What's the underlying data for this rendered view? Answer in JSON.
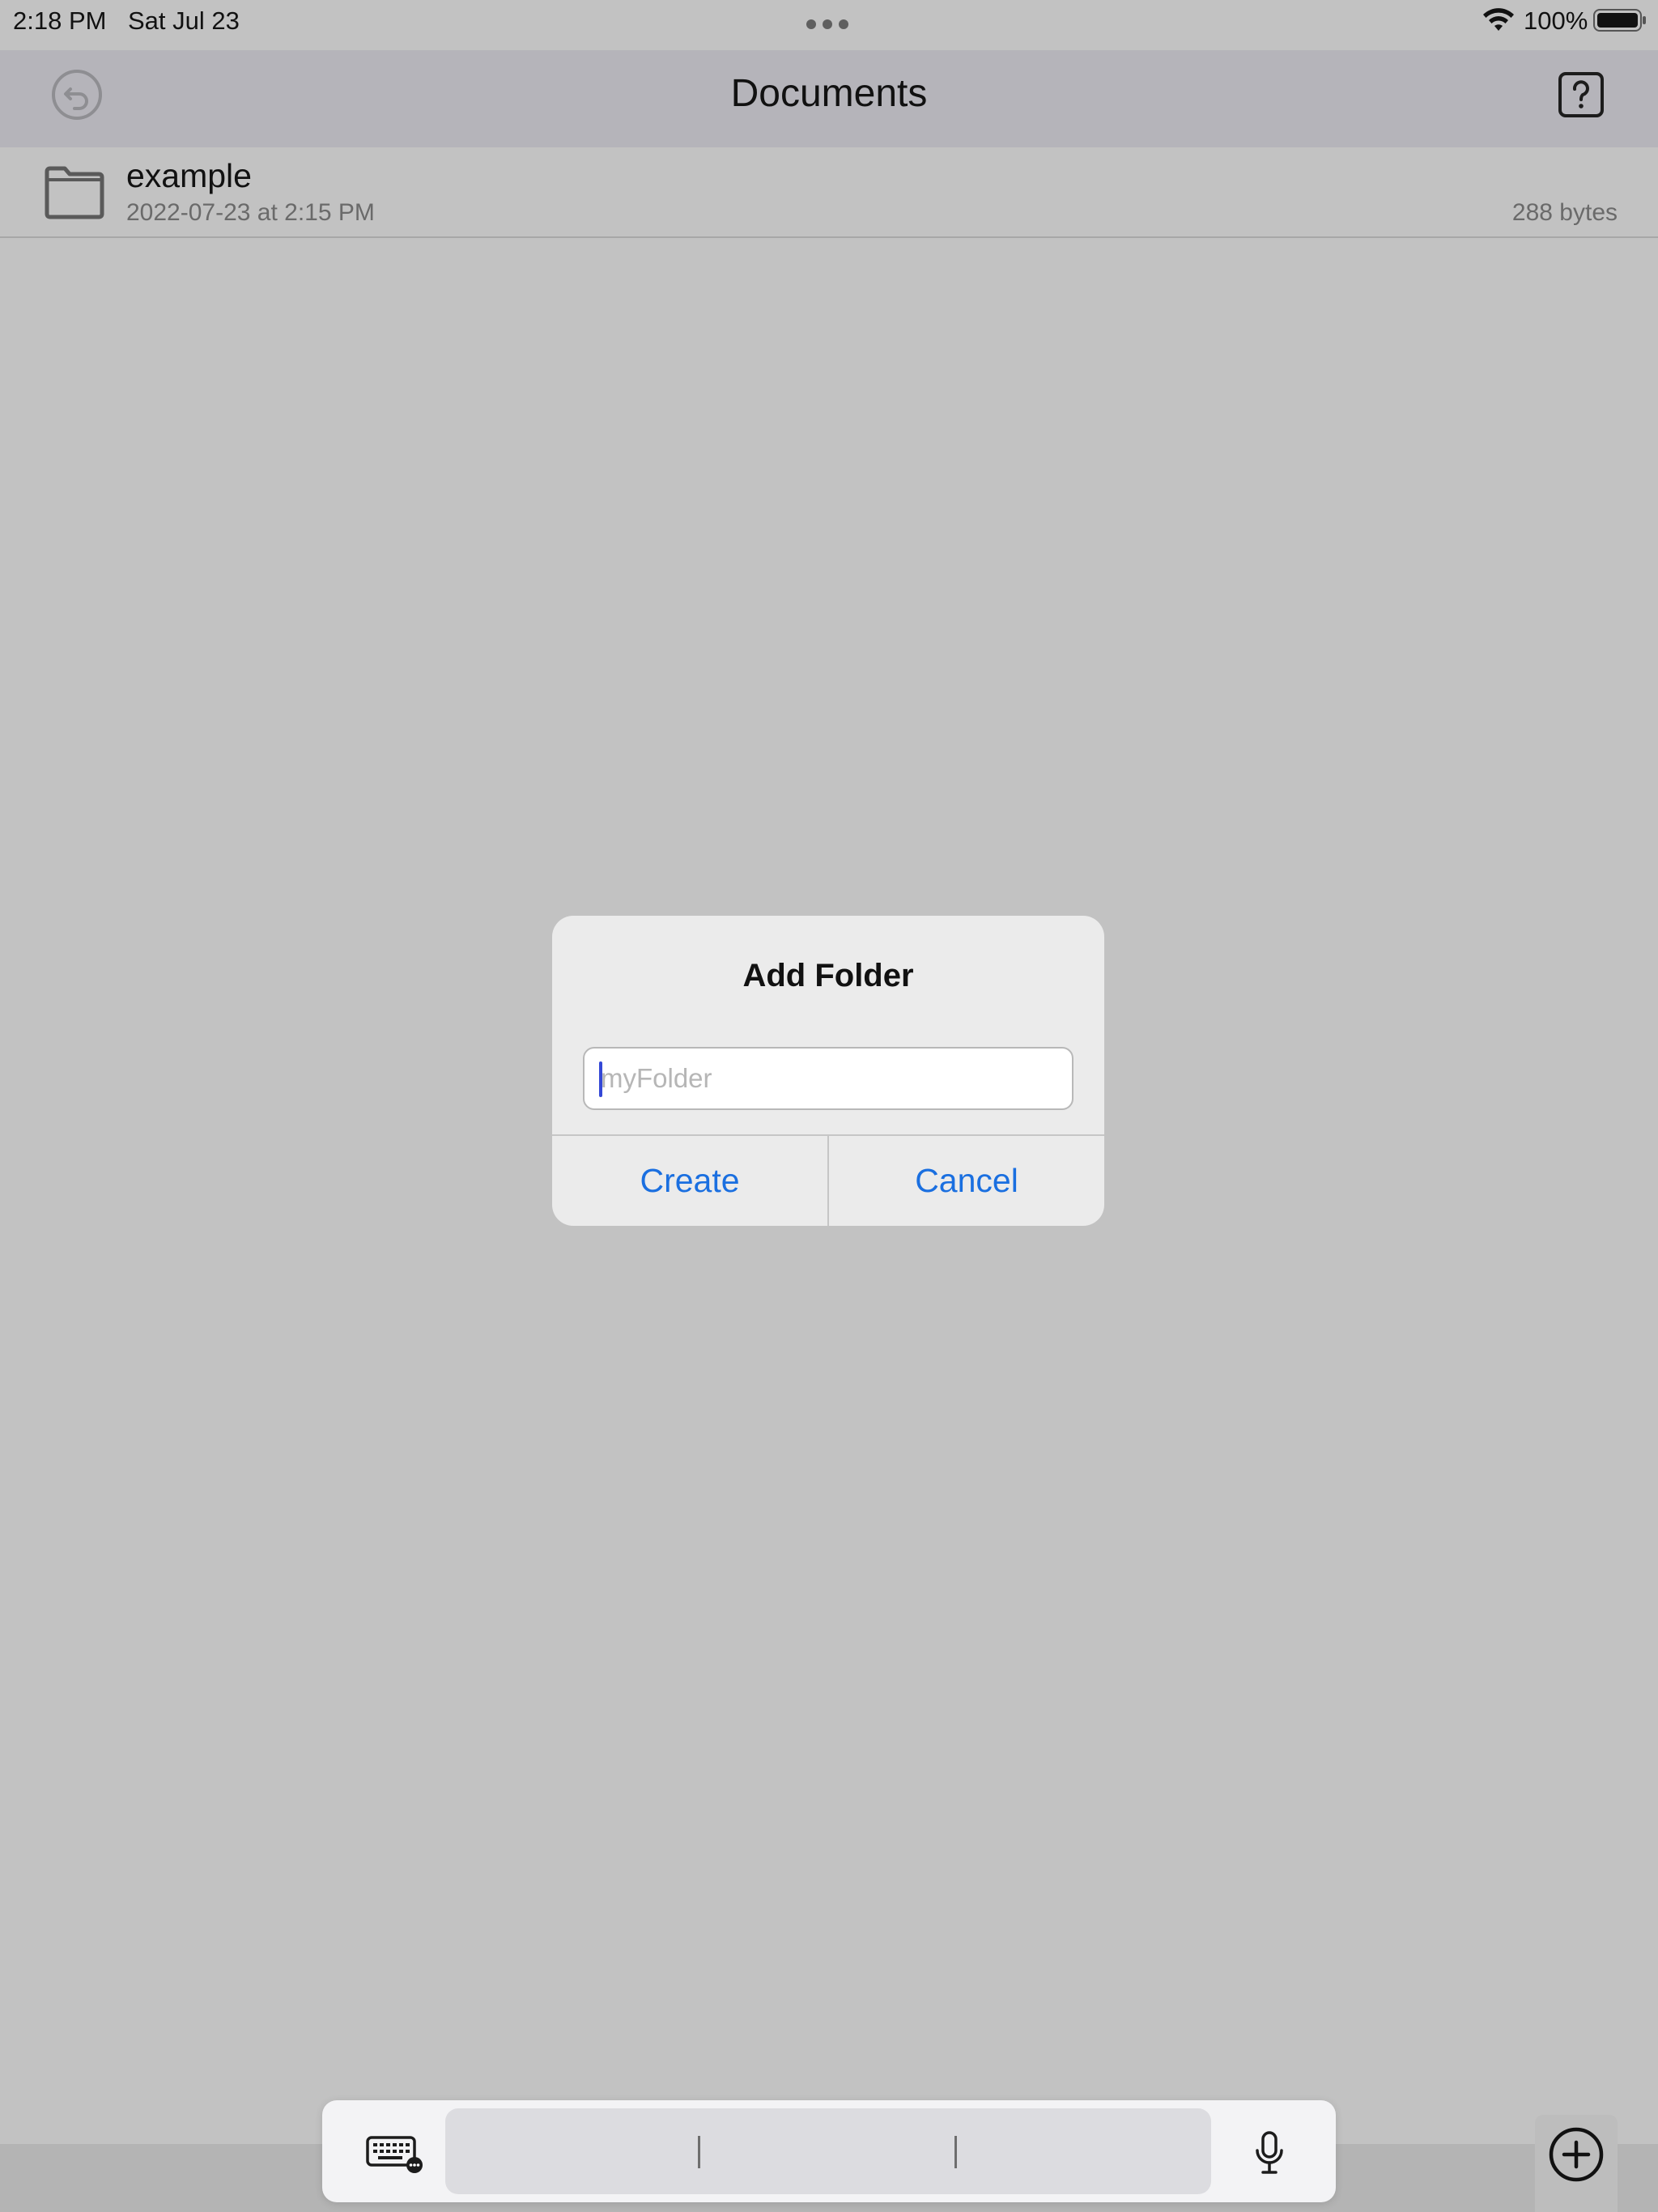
{
  "status_bar": {
    "time": "2:18 PM",
    "date": "Sat Jul 23",
    "battery": "100%"
  },
  "nav": {
    "title": "Documents",
    "back_icon": "undo-arrow-icon",
    "help_icon": "question-square-icon"
  },
  "files": [
    {
      "name": "example",
      "date": "2022-07-23 at 2:15 PM",
      "size": "288 bytes",
      "icon": "folder-icon"
    }
  ],
  "alert": {
    "title": "Add Folder",
    "input_value": "",
    "input_placeholder": "myFolder",
    "create_label": "Create",
    "cancel_label": "Cancel"
  },
  "keyboard_bar": {
    "left_icon": "keyboard-icon",
    "right_icon": "microphone-icon"
  },
  "toolbar": {
    "add_icon": "plus-circle-icon"
  },
  "colors": {
    "background": "#c2c2c2",
    "navbar": "#b5b4ba",
    "alert_bg": "#ebebeb",
    "accent": "#1a6fe0",
    "caret": "#3448d6"
  }
}
